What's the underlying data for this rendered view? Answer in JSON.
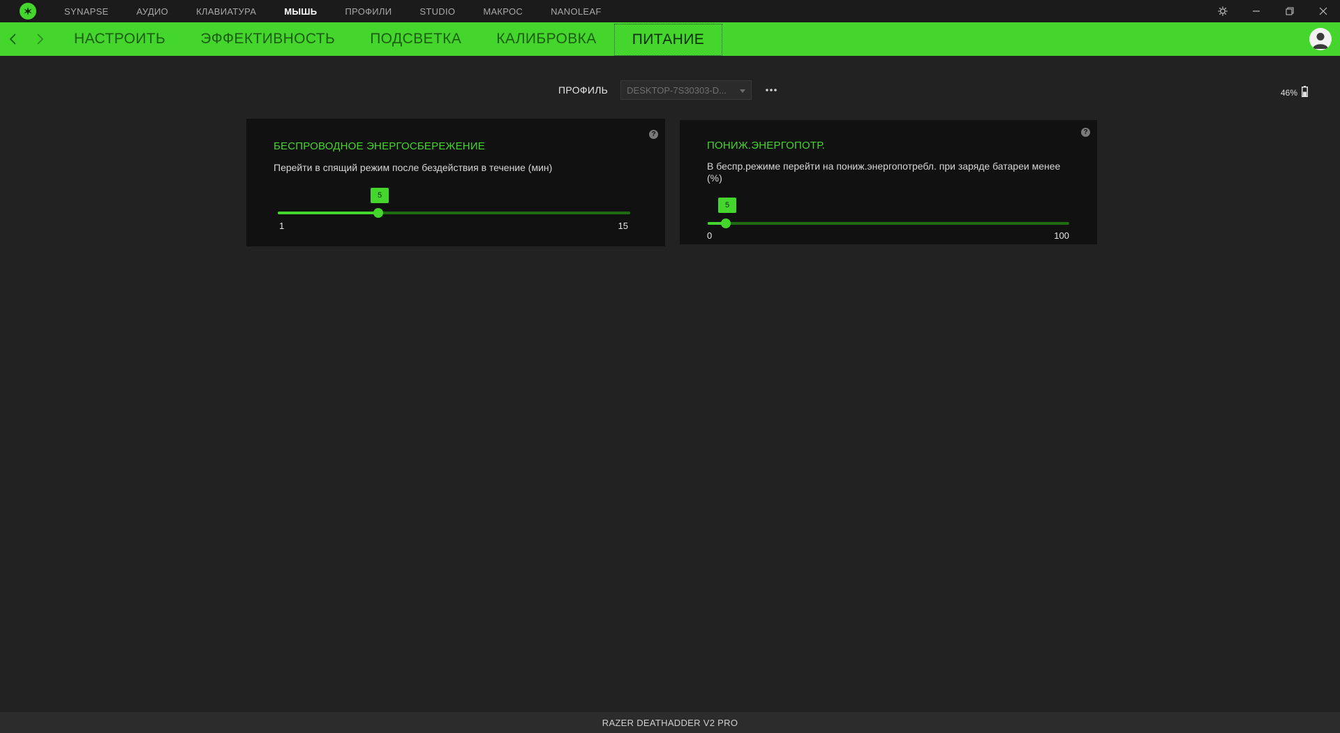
{
  "topnav": {
    "items": [
      "SYNAPSE",
      "АУДИО",
      "КЛАВИАТУРА",
      "МЫШЬ",
      "ПРОФИЛИ",
      "STUDIO",
      "МАКРОС",
      "NANOLEAF"
    ],
    "active": "МЫШЬ"
  },
  "subnav": {
    "tabs": [
      "НАСТРОИТЬ",
      "ЭФФЕКТИВНОСТЬ",
      "ПОДСВЕТКА",
      "КАЛИБРОВКА",
      "ПИТАНИЕ"
    ],
    "active": "ПИТАНИЕ"
  },
  "profile": {
    "label": "ПРОФИЛЬ",
    "selected": "DESKTOP-7S30303-D..."
  },
  "battery": {
    "percent_text": "46%",
    "level": 0.46
  },
  "panels": {
    "sleep": {
      "title": "БЕСПРОВОДНОЕ ЭНЕРГОСБЕРЕЖЕНИЕ",
      "description": "Перейти в спящий режим после бездействия в течение (мин)",
      "slider": {
        "min": 1,
        "max": 15,
        "value": 5,
        "min_label": "1",
        "max_label": "15",
        "value_label": "5"
      }
    },
    "low_power": {
      "title": "ПОНИЖ.ЭНЕРГОПОТР.",
      "description": "В беспр.режиме перейти на пониж.энергопотребл. при заряде батареи менее (%)",
      "slider": {
        "min": 0,
        "max": 100,
        "value": 5,
        "min_label": "0",
        "max_label": "100",
        "value_label": "5"
      }
    }
  },
  "statusbar": {
    "device": "RAZER DEATHADDER V2 PRO"
  },
  "colors": {
    "accent": "#44d62c",
    "background": "#222222",
    "panel": "#111111"
  },
  "icons": {
    "logo": "razer-logo-icon",
    "settings": "gear-icon",
    "minimize": "minimize-icon",
    "restore": "restore-icon",
    "close": "close-icon",
    "back": "chevron-left-icon",
    "forward": "chevron-right-icon",
    "avatar": "user-avatar-icon",
    "more": "more-options-icon",
    "dropdown": "caret-down-icon",
    "help": "help-icon",
    "battery": "battery-icon"
  }
}
